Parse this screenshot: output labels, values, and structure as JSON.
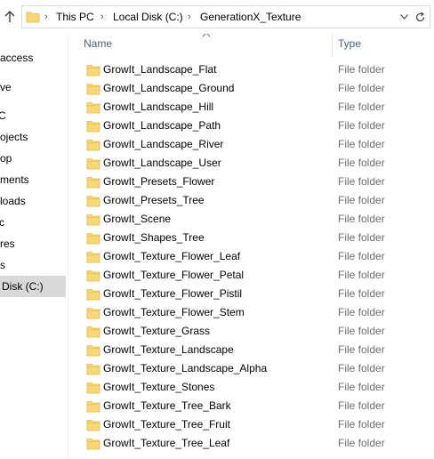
{
  "address_bar": {
    "crumbs": [
      "This PC",
      "Local Disk (C:)",
      "GenerationX_Texture"
    ]
  },
  "nav_pane": {
    "items": [
      {
        "label": "access",
        "selected": false
      },
      {
        "label": "ve",
        "selected": false
      },
      {
        "label": "C",
        "selected": false
      },
      {
        "label": "ojects",
        "selected": false
      },
      {
        "label": "op",
        "selected": false
      },
      {
        "label": "ments",
        "selected": false
      },
      {
        "label": "loads",
        "selected": false
      },
      {
        "label": "c",
        "selected": false
      },
      {
        "label": "res",
        "selected": false
      },
      {
        "label": "s",
        "selected": false
      },
      {
        "label": "Disk (C:)",
        "selected": true
      }
    ]
  },
  "file_list": {
    "columns": {
      "name": "Name",
      "type": "Type"
    },
    "items": [
      {
        "name": "GrowIt_Landscape_Flat",
        "type": "File folder"
      },
      {
        "name": "GrowIt_Landscape_Ground",
        "type": "File folder"
      },
      {
        "name": "GrowIt_Landscape_Hill",
        "type": "File folder"
      },
      {
        "name": "GrowIt_Landscape_Path",
        "type": "File folder"
      },
      {
        "name": "GrowIt_Landscape_River",
        "type": "File folder"
      },
      {
        "name": "GrowIt_Landscape_User",
        "type": "File folder"
      },
      {
        "name": "GrowIt_Presets_Flower",
        "type": "File folder"
      },
      {
        "name": "GrowIt_Presets_Tree",
        "type": "File folder"
      },
      {
        "name": "GrowIt_Scene",
        "type": "File folder"
      },
      {
        "name": "GrowIt_Shapes_Tree",
        "type": "File folder"
      },
      {
        "name": "GrowIt_Texture_Flower_Leaf",
        "type": "File folder"
      },
      {
        "name": "GrowIt_Texture_Flower_Petal",
        "type": "File folder"
      },
      {
        "name": "GrowIt_Texture_Flower_Pistil",
        "type": "File folder"
      },
      {
        "name": "GrowIt_Texture_Flower_Stem",
        "type": "File folder"
      },
      {
        "name": "GrowIt_Texture_Grass",
        "type": "File folder"
      },
      {
        "name": "GrowIt_Texture_Landscape",
        "type": "File folder"
      },
      {
        "name": "GrowIt_Texture_Landscape_Alpha",
        "type": "File folder"
      },
      {
        "name": "GrowIt_Texture_Stones",
        "type": "File folder"
      },
      {
        "name": "GrowIt_Texture_Tree_Bark",
        "type": "File folder"
      },
      {
        "name": "GrowIt_Texture_Tree_Fruit",
        "type": "File folder"
      },
      {
        "name": "GrowIt_Texture_Tree_Leaf",
        "type": "File folder"
      }
    ]
  },
  "icons": {
    "up": "up-arrow-icon",
    "folder": "folder-icon",
    "chevron": "chevron-down-icon",
    "refresh": "refresh-icon",
    "sort": "sort-up-icon"
  },
  "colors": {
    "folder_body": "#f8d775",
    "folder_tab": "#e5b84a",
    "header_text": "#4c607a",
    "type_text": "#6d6d6d",
    "selected_bg": "#d9d9d9"
  }
}
